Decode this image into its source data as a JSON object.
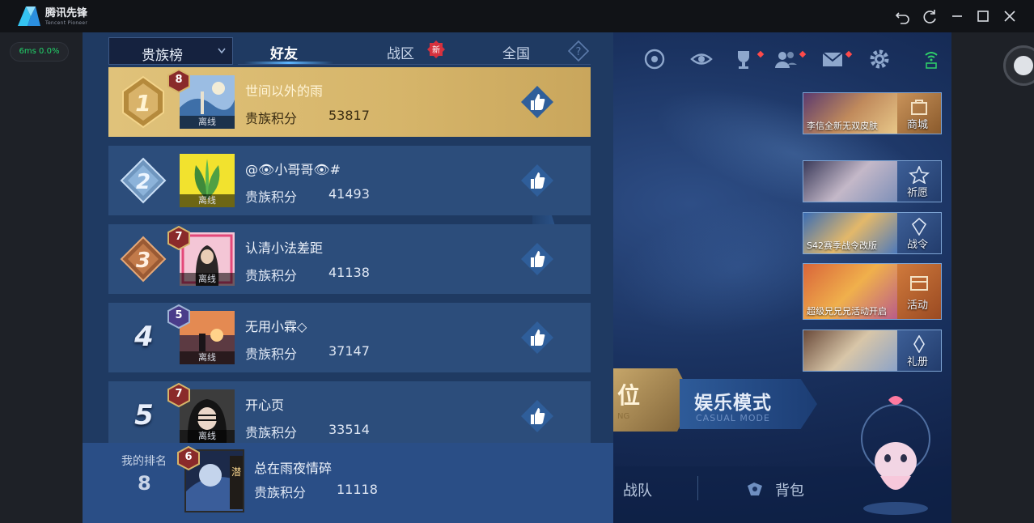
{
  "app": {
    "name": "腾讯先锋",
    "subtitle": "Tencent Pioneer",
    "fps_text": "6ms 0.0%",
    "window_buttons": [
      "undo-icon",
      "refresh-icon",
      "minimize-icon",
      "maximize-icon",
      "close-icon"
    ]
  },
  "tabs": {
    "dropdown_label": "贵族榜",
    "items": [
      {
        "label": "好友",
        "active": true
      },
      {
        "label": "战区",
        "active": false,
        "badge": "新"
      },
      {
        "label": "全国",
        "active": false
      }
    ]
  },
  "leaderboard": {
    "score_label": "贵族积分",
    "offline_label": "离线",
    "rows": [
      {
        "rank": "1",
        "name": "世间以外的雨",
        "score": "53817",
        "level": "8"
      },
      {
        "rank": "2",
        "name": "@👁小哥哥👁#",
        "score": "41493",
        "level": ""
      },
      {
        "rank": "3",
        "name": "认清小法差距",
        "score": "41138",
        "level": "7"
      },
      {
        "rank": "4",
        "name": "无用小霖◇",
        "score": "37147",
        "level": "5"
      },
      {
        "rank": "5",
        "name": "开心页",
        "score": "33514",
        "level": "7"
      }
    ]
  },
  "my_rank": {
    "label": "我的排名",
    "rank": "8",
    "name": "总在雨夜情碎",
    "score_label": "贵族积分",
    "score": "11118",
    "level": "6"
  },
  "game": {
    "banners": [
      {
        "caption": "李信全新无双皮肤",
        "side_label": "商城"
      },
      {
        "caption": "",
        "side_label": "祈愿"
      },
      {
        "caption": "S42赛季战令改版",
        "side_label": "战令"
      },
      {
        "caption": "超级兄兄兄活动开启",
        "side_label": "活动"
      },
      {
        "caption": "",
        "side_label": "礼册"
      }
    ],
    "mode_left": {
      "label": "位",
      "sub": "NG"
    },
    "mode_right": {
      "label": "娱乐模式",
      "sub": "CASUAL MODE"
    },
    "bottom_items": [
      "战队",
      "背包"
    ]
  },
  "colors": {
    "panel_bg": "#1f3a62",
    "row_bg": "#2c4d7b",
    "first_row_gold": "#d6b56a",
    "fps_green": "#22d36a",
    "accent_blue": "#5eb6ff"
  }
}
